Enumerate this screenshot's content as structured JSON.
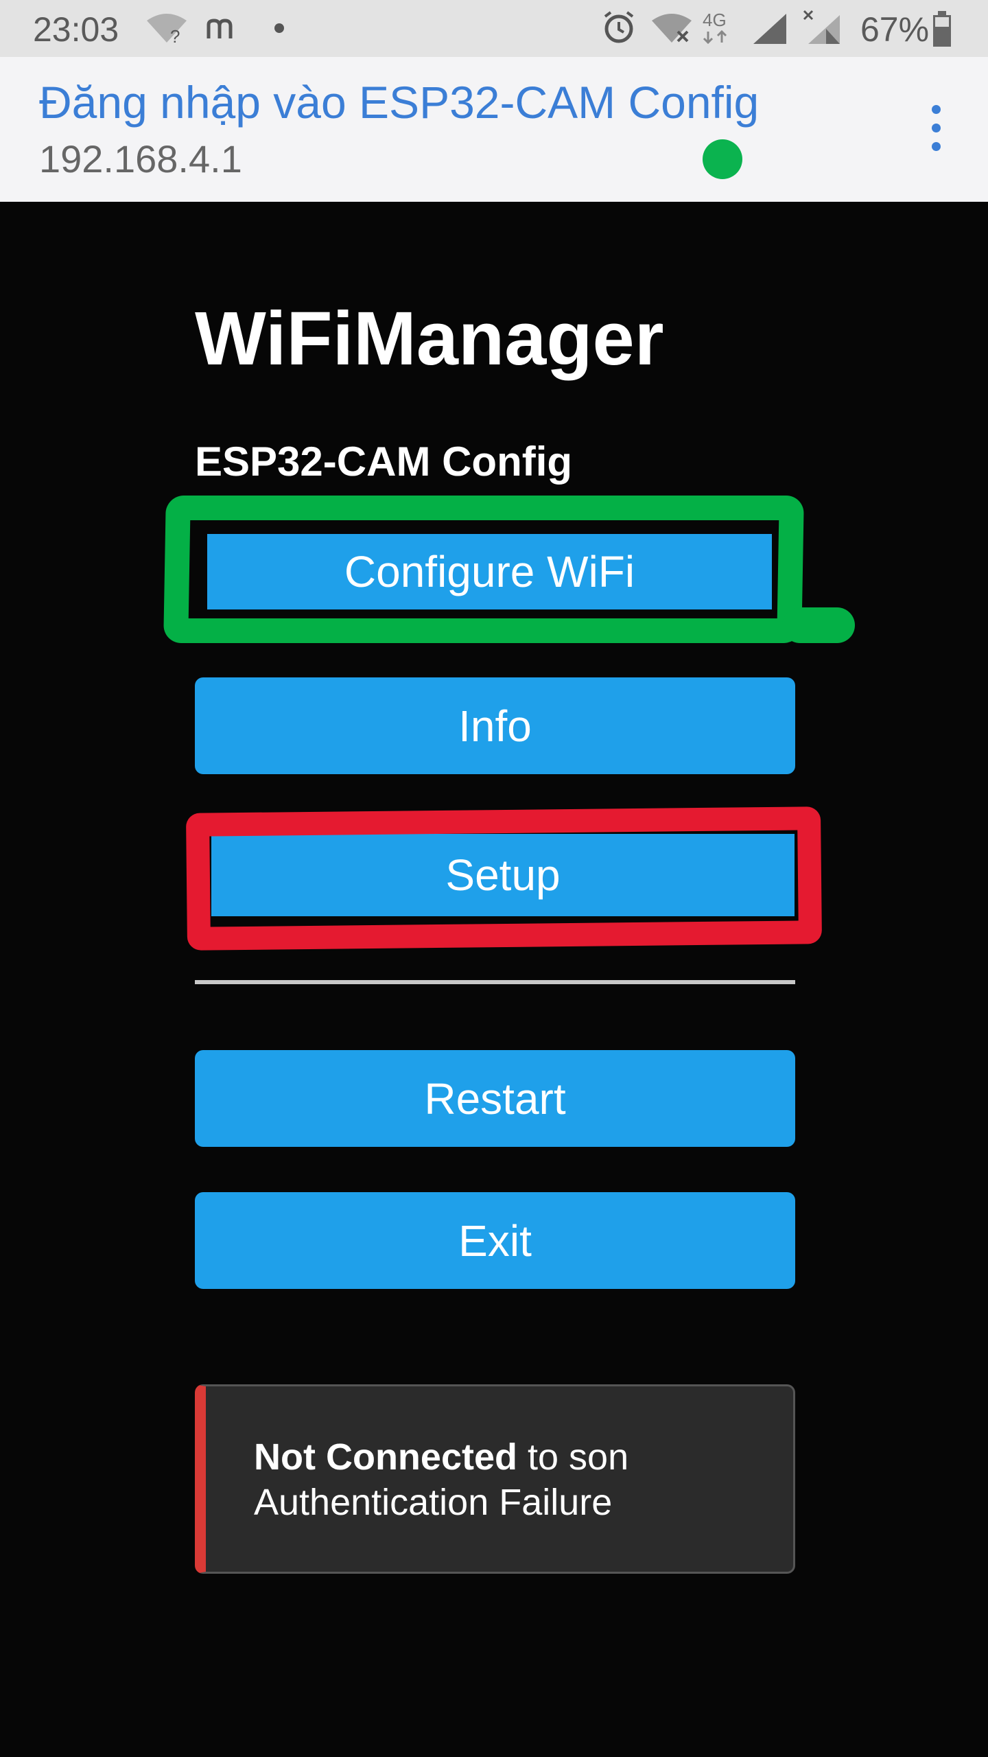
{
  "status_bar": {
    "time": "23:03",
    "battery": "67%",
    "network": "4G",
    "icons": [
      "wifi-question-icon",
      "m-icon",
      "dot-icon",
      "alarm-icon",
      "wifi-off-icon",
      "4g-icon",
      "signal-icon",
      "signal-x-icon",
      "battery-icon"
    ]
  },
  "browser": {
    "title": "Đăng nhập vào ESP32-CAM Config",
    "url": "192.168.4.1",
    "status_dot_color": "#0bb34f",
    "menu_icon": "more-vert-icon"
  },
  "page": {
    "title": "WiFiManager",
    "subtitle": "ESP32-CAM Config",
    "buttons": {
      "configure_wifi": "Configure WiFi",
      "info": "Info",
      "setup": "Setup",
      "restart": "Restart",
      "exit": "Exit"
    },
    "alert": {
      "strong": "Not Connected",
      "text": " to son",
      "detail": "Authentication Failure"
    }
  },
  "annotations": {
    "green_highlight_color": "#04b046",
    "red_highlight_color": "#e51a30"
  },
  "colors": {
    "button": "#1fa0ea",
    "background": "#060606",
    "accent": "#3b7ed6"
  }
}
